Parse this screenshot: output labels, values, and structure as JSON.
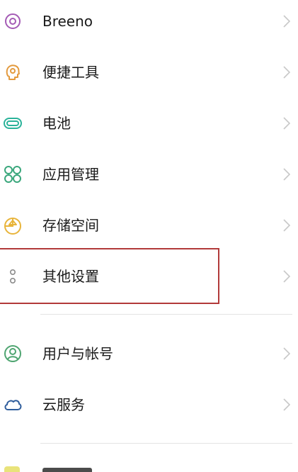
{
  "colors": {
    "breeno": "#a45bb5",
    "shortcuts": "#e39a3e",
    "battery": "#2bb39a",
    "apps": "#3aa77c",
    "storage": "#e8b43a",
    "other": "#8a8a8a",
    "accounts": "#4fa571",
    "cloud": "#2f5d9c",
    "chevron": "#c8c8c8",
    "highlight_border": "#b23a3a"
  },
  "settings": {
    "items": [
      {
        "label": "Breeno",
        "icon": "breeno-icon"
      },
      {
        "label": "便捷工具",
        "icon": "convenience-tools-icon"
      },
      {
        "label": "电池",
        "icon": "battery-icon"
      },
      {
        "label": "应用管理",
        "icon": "app-management-icon"
      },
      {
        "label": "存储空间",
        "icon": "storage-icon"
      },
      {
        "label": "其他设置",
        "icon": "other-settings-icon"
      },
      {
        "label": "用户与帐号",
        "icon": "user-account-icon"
      },
      {
        "label": "云服务",
        "icon": "cloud-icon"
      }
    ]
  }
}
